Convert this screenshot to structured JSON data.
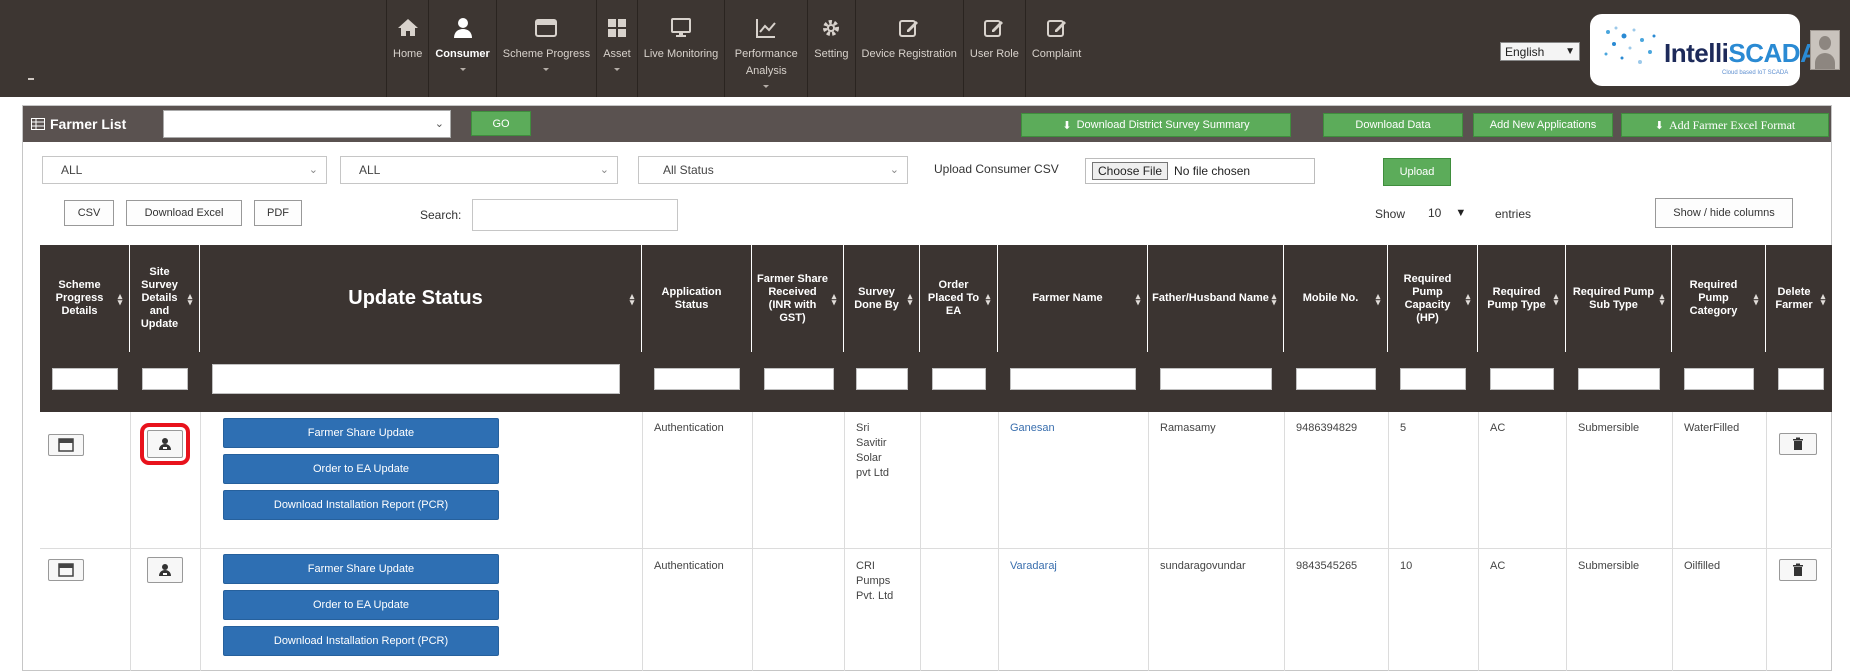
{
  "nav": {
    "items": [
      {
        "label": "Home",
        "icon": "home-icon"
      },
      {
        "label": "Consumer",
        "icon": "user-icon",
        "active": true
      },
      {
        "label": "Scheme Progress",
        "icon": "window-icon"
      },
      {
        "label": "Asset",
        "icon": "grid-icon"
      },
      {
        "label": "Live Monitoring",
        "icon": "monitor-icon"
      },
      {
        "label": "Performance Analysis",
        "icon": "chart-icon"
      },
      {
        "label": "Setting",
        "icon": "gear-icon"
      },
      {
        "label": "Device Registration",
        "icon": "edit-icon"
      },
      {
        "label": "User Role",
        "icon": "edit-icon"
      },
      {
        "label": "Complaint",
        "icon": "edit-icon"
      }
    ],
    "language": "English",
    "logo_text_dark": "Intelli",
    "logo_text_blue": "SCADA",
    "logo_tagline": "Cloud based IoT SCADA"
  },
  "listbar": {
    "title": "Farmer List",
    "go": "GO",
    "download_summary": "Download District Survey Summary",
    "download_data": "Download Data",
    "add_new": "Add New Applications",
    "add_excel": "Add Farmer Excel Format"
  },
  "filters": {
    "filter1": "ALL",
    "filter2": "ALL",
    "status": "All Status",
    "upload_label": "Upload Consumer CSV",
    "choose_file": "Choose File",
    "no_file": "No file chosen",
    "upload": "Upload"
  },
  "toolbar": {
    "csv": "CSV",
    "excel": "Download Excel",
    "pdf": "PDF",
    "search_label": "Search:",
    "show": "Show",
    "entries_value": "10",
    "entries": "entries",
    "show_hide": "Show / hide columns"
  },
  "table": {
    "headers": {
      "scheme": "Scheme Progress Details",
      "site": "Site Survey Details and Update",
      "update": "Update Status",
      "app_status": "Application Status",
      "share": "Farmer Share Received (INR with GST)",
      "survey": "Survey Done By",
      "order": "Order Placed To EA",
      "farmer": "Farmer Name",
      "father": "Father/Husband Name",
      "mobile": "Mobile No.",
      "capacity": "Required Pump Capacity (HP)",
      "ptype": "Required Pump Type",
      "psub": "Required Pump Sub Type",
      "pcat": "Required Pump Category",
      "delete": "Delete Farmer"
    },
    "buttons": {
      "share": "Farmer Share Update",
      "order": "Order to EA Update",
      "pcr": "Download Installation Report (PCR)"
    },
    "rows": [
      {
        "app_status": "Authentication",
        "survey_lines": [
          "Sri",
          "Savitir",
          "Solar",
          "pvt Ltd"
        ],
        "farmer": "Ganesan",
        "father": "Ramasamy",
        "mobile": "9486394829",
        "capacity": "5",
        "ptype": "AC",
        "psub": "Submersible",
        "pcat": "WaterFilled"
      },
      {
        "app_status": "Authentication",
        "survey_lines": [
          "CRI",
          "Pumps",
          "Pvt. Ltd"
        ],
        "farmer": "Varadaraj",
        "father": "sundaragovundar",
        "mobile": "9843545265",
        "capacity": "10",
        "ptype": "AC",
        "psub": "Submersible",
        "pcat": "Oilfilled"
      }
    ]
  },
  "colors": {
    "navbar": "#3d3632",
    "listbar": "#5a5250",
    "green": "#5cac5a",
    "blue": "#2e6fb3",
    "highlight": "#e8121c"
  }
}
